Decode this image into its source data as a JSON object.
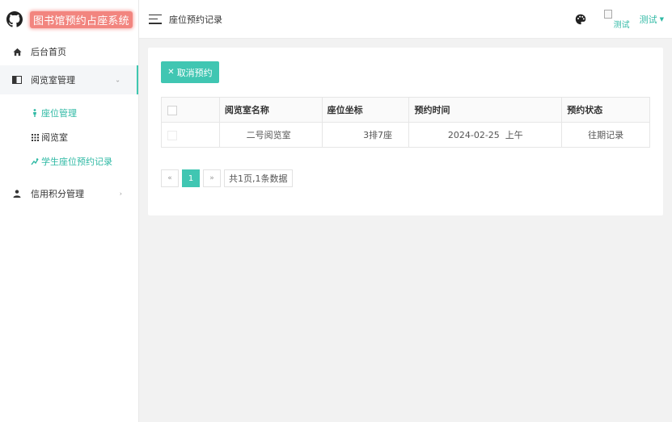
{
  "app": {
    "title": "图书馆预约占座系统"
  },
  "sidebar": {
    "items": [
      {
        "label": "后台首页",
        "icon": "home-icon"
      },
      {
        "label": "阅览室管理",
        "icon": "book-icon",
        "expanded": true,
        "children": [
          {
            "label": "座位管理",
            "icon": "seat-icon"
          },
          {
            "label": "阅览室",
            "icon": "grid-icon"
          },
          {
            "label": "学生座位预约记录",
            "icon": "reservation-icon"
          }
        ]
      },
      {
        "label": "信用积分管理",
        "icon": "user-icon"
      }
    ]
  },
  "header": {
    "page_title": "座位预约记录",
    "avatar_alt": "测试",
    "user_name": "测试"
  },
  "toolbar": {
    "cancel_label": "取消预约"
  },
  "table": {
    "columns": [
      "阅览室名称",
      "座位坐标",
      "预约时间",
      "预约状态"
    ],
    "rows": [
      {
        "room": "二号阅览室",
        "seat": "3排7座",
        "time": "2024-02-25  上午",
        "status": "往期记录"
      }
    ]
  },
  "pagination": {
    "prev": "«",
    "current": "1",
    "next": "»",
    "summary": "共1页,1条数据"
  },
  "colors": {
    "accent": "#40c6b2",
    "accent_text": "#2fb9a4",
    "title_badge": "#f2857f"
  }
}
